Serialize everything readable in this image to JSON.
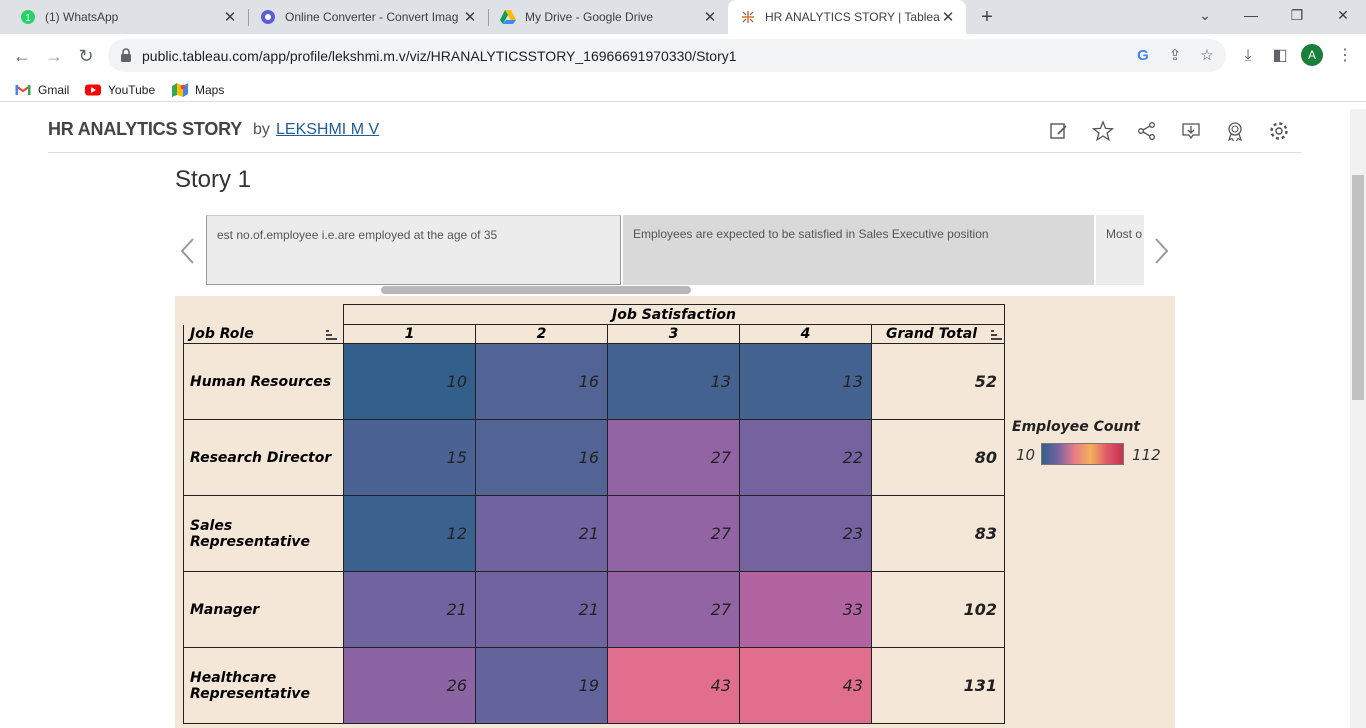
{
  "browser": {
    "tabs": [
      {
        "title": "(1) WhatsApp",
        "active": false
      },
      {
        "title": "Online Converter - Convert Imag",
        "active": false
      },
      {
        "title": "My Drive - Google Drive",
        "active": false
      },
      {
        "title": "HR ANALYTICS STORY | Tableau",
        "active": true
      }
    ],
    "url": "public.tableau.com/app/profile/lekshmi.m.v/viz/HRANALYTICSSTORY_16966691970330/Story1",
    "bookmarks": [
      {
        "label": "Gmail"
      },
      {
        "label": "YouTube"
      },
      {
        "label": "Maps"
      }
    ],
    "profile_initial": "A"
  },
  "viz": {
    "title": "HR ANALYTICS STORY",
    "by": "by",
    "author": "LEKSHMI M V",
    "story_title": "Story 1",
    "story_points": [
      "est no.of.employee i.e.are employed at the age of 35",
      "Employees are expected to be satisfied in Sales Executive position",
      "Most o"
    ]
  },
  "crosstab": {
    "col_group_header": "Job Satisfaction",
    "row_header": "Job Role",
    "columns": [
      "1",
      "2",
      "3",
      "4"
    ],
    "grand_total_header": "Grand Total",
    "rows": [
      {
        "role": "Human Resources",
        "values": [
          "10",
          "16",
          "13",
          "13"
        ],
        "total": "52"
      },
      {
        "role": "Research Director",
        "values": [
          "15",
          "16",
          "27",
          "22"
        ],
        "total": "80"
      },
      {
        "role": "Sales Representative",
        "values": [
          "12",
          "21",
          "27",
          "23"
        ],
        "total": "83"
      },
      {
        "role": "Manager",
        "values": [
          "21",
          "21",
          "27",
          "33"
        ],
        "total": "102"
      },
      {
        "role": "Healthcare Representative",
        "values": [
          "26",
          "19",
          "43",
          "43"
        ],
        "total": "131"
      }
    ],
    "cell_colors": [
      [
        "#335f8c",
        "#526495",
        "#44628f",
        "#44628f"
      ],
      [
        "#4b6394",
        "#526495",
        "#9264a3",
        "#7563a0"
      ],
      [
        "#3b618e",
        "#6f63a0",
        "#9264a3",
        "#7563a0"
      ],
      [
        "#6f63a0",
        "#6f63a0",
        "#9264a3",
        "#b264a0"
      ],
      [
        "#8c64a3",
        "#62649b",
        "#e06e8c",
        "#e06e8c"
      ]
    ]
  },
  "legend": {
    "title": "Employee Count",
    "min": "10",
    "max": "112",
    "gradient": [
      "#33608d",
      "#7563a0",
      "#e97b8a",
      "#f2b15a",
      "#e05a6a",
      "#c7304f"
    ]
  }
}
